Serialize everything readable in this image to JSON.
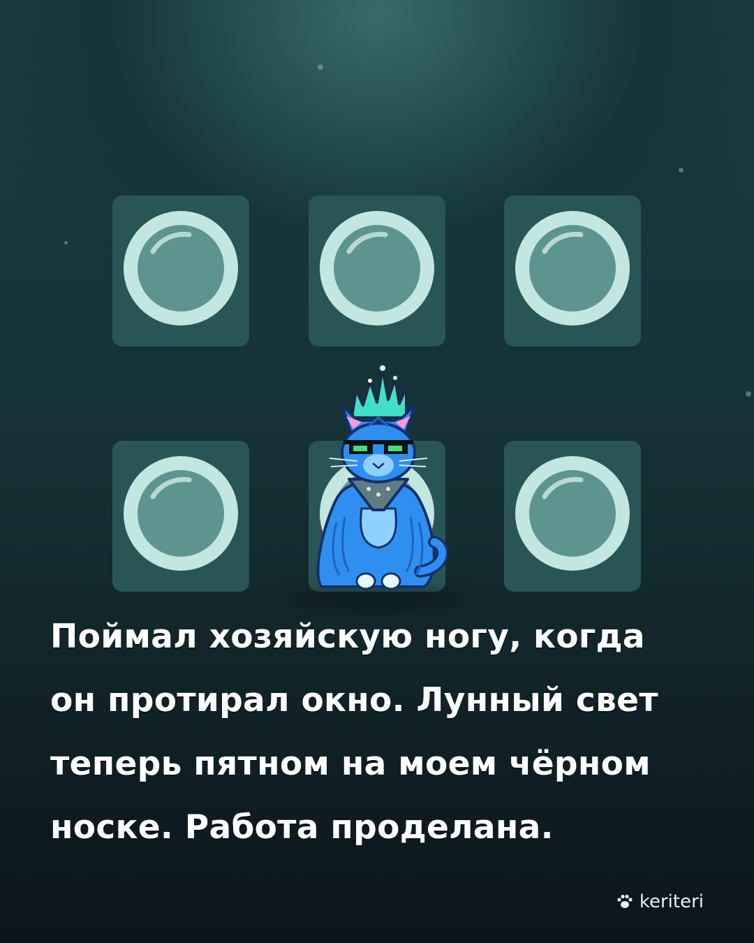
{
  "caption": {
    "line1": "Поймал хозяйскую ногу, когда",
    "line2": "он протирал окно. Лунный свет",
    "line3": "теперь пятном на моем чёрном",
    "line4": "носке. Работа проделана."
  },
  "brand": {
    "name": "keriteri",
    "icon": "paw-icon"
  },
  "colors": {
    "background_top": "#3a6a68",
    "background_bottom": "#0b151b",
    "tile": "#2a5556",
    "porthole_ring": "#c4e6e0",
    "porthole_glass": "#5e9490",
    "cat_body": "#2f8ff0",
    "cat_mohawk": "#3fe0c8"
  }
}
